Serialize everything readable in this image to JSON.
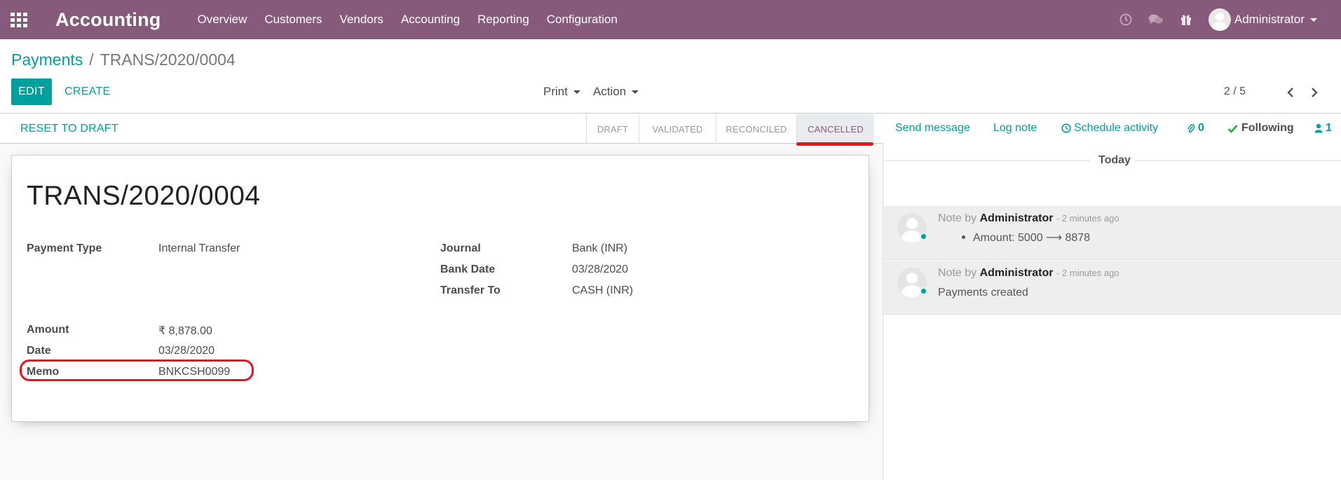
{
  "navbar": {
    "app_title": "Accounting",
    "menu": [
      "Overview",
      "Customers",
      "Vendors",
      "Accounting",
      "Reporting",
      "Configuration"
    ],
    "user_name": "Administrator",
    "icons": [
      "apps-grid-icon",
      "clock-icon",
      "chat-icon",
      "gift-icon"
    ]
  },
  "breadcrumb": {
    "parent": "Payments",
    "separator": "/",
    "current": "TRANS/2020/0004"
  },
  "toolbar": {
    "edit_label": "EDIT",
    "create_label": "CREATE",
    "print_label": "Print",
    "action_label": "Action"
  },
  "pager": {
    "value": "2 / 5"
  },
  "statusbar": {
    "reset_label": "RESET TO DRAFT",
    "steps": [
      "DRAFT",
      "VALIDATED",
      "RECONCILED",
      "CANCELLED"
    ],
    "active_step": "CANCELLED"
  },
  "form": {
    "title": "TRANS/2020/0004",
    "left": [
      {
        "label": "Payment Type",
        "value": "Internal Transfer"
      },
      {
        "label": "Amount",
        "value": "₹ 8,878.00"
      },
      {
        "label": "Date",
        "value": "03/28/2020"
      },
      {
        "label": "Memo",
        "value": "BNKCSH0099"
      }
    ],
    "right": [
      {
        "label": "Journal",
        "value": "Bank (INR)"
      },
      {
        "label": "Bank Date",
        "value": "03/28/2020"
      },
      {
        "label": "Transfer To",
        "value": "CASH (INR)"
      }
    ]
  },
  "chatter": {
    "send_message": "Send message",
    "log_note": "Log note",
    "schedule_activity": "Schedule activity",
    "attachments_count": "0",
    "following_label": "Following",
    "followers_count": "1",
    "day_separator": "Today",
    "messages": [
      {
        "prefix": "Note by",
        "author": "Administrator",
        "time": "- 2 minutes ago",
        "body": "Amount: 5000 ⟶ 8878"
      },
      {
        "prefix": "Note by",
        "author": "Administrator",
        "time": "- 2 minutes ago",
        "body": "Payments created"
      }
    ]
  },
  "colors": {
    "brand": "#875a7b",
    "accent": "#00a09d",
    "annotation": "#e8141c"
  }
}
